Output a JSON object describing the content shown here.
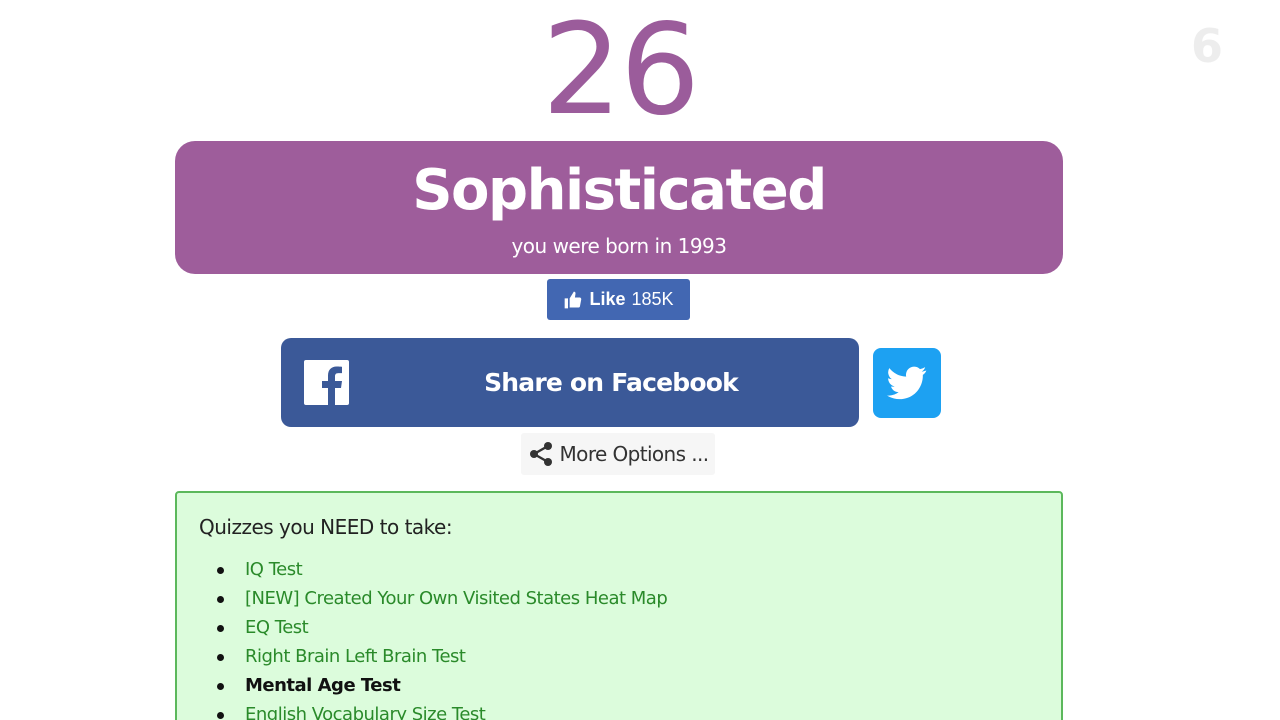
{
  "watermark": {
    "text": "6"
  },
  "result": {
    "age": "26",
    "title": "Sophisticated",
    "subtitle": "you were born in 1993",
    "card_color": "#9e5d9b"
  },
  "like_button": {
    "label": "Like",
    "count": "185K",
    "icon": "thumbs-up-icon"
  },
  "share": {
    "facebook_label": "Share on Facebook",
    "facebook_icon": "facebook-icon",
    "twitter_icon": "twitter-bird-icon",
    "more_options_label": "More Options ...",
    "more_options_icon": "share-icon"
  },
  "quizzes": {
    "heading": "Quizzes you NEED to take:",
    "items": [
      {
        "label": "IQ Test",
        "current": false
      },
      {
        "label": "[NEW] Created Your Own Visited States Heat Map",
        "current": false
      },
      {
        "label": "EQ Test",
        "current": false
      },
      {
        "label": "Right Brain Left Brain Test",
        "current": false
      },
      {
        "label": "Mental Age Test",
        "current": true
      },
      {
        "label": "English Vocabulary Size Test",
        "current": false
      }
    ]
  },
  "colors": {
    "accent_purple": "#9e5d9b",
    "facebook_blue": "#3b5998",
    "like_blue": "#4267b2",
    "twitter_blue": "#1da1f2",
    "quiz_bg": "#dcfcdc",
    "quiz_border": "#5cb85c",
    "link_green": "#2a8a2a"
  }
}
